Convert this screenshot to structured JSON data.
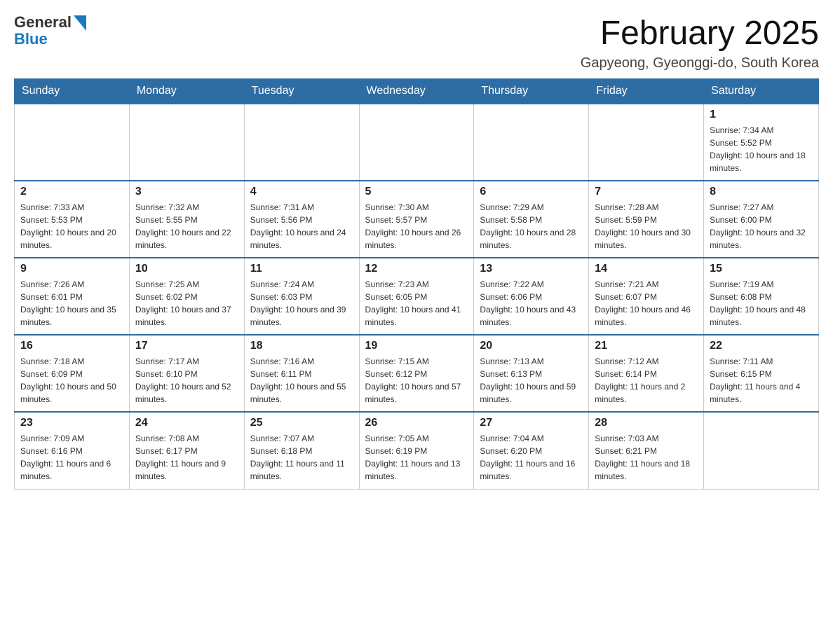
{
  "logo": {
    "general": "General",
    "blue": "Blue"
  },
  "title": "February 2025",
  "subtitle": "Gapyeong, Gyeonggi-do, South Korea",
  "days_of_week": [
    "Sunday",
    "Monday",
    "Tuesday",
    "Wednesday",
    "Thursday",
    "Friday",
    "Saturday"
  ],
  "weeks": [
    [
      {
        "day": "",
        "sunrise": "",
        "sunset": "",
        "daylight": ""
      },
      {
        "day": "",
        "sunrise": "",
        "sunset": "",
        "daylight": ""
      },
      {
        "day": "",
        "sunrise": "",
        "sunset": "",
        "daylight": ""
      },
      {
        "day": "",
        "sunrise": "",
        "sunset": "",
        "daylight": ""
      },
      {
        "day": "",
        "sunrise": "",
        "sunset": "",
        "daylight": ""
      },
      {
        "day": "",
        "sunrise": "",
        "sunset": "",
        "daylight": ""
      },
      {
        "day": "1",
        "sunrise": "Sunrise: 7:34 AM",
        "sunset": "Sunset: 5:52 PM",
        "daylight": "Daylight: 10 hours and 18 minutes."
      }
    ],
    [
      {
        "day": "2",
        "sunrise": "Sunrise: 7:33 AM",
        "sunset": "Sunset: 5:53 PM",
        "daylight": "Daylight: 10 hours and 20 minutes."
      },
      {
        "day": "3",
        "sunrise": "Sunrise: 7:32 AM",
        "sunset": "Sunset: 5:55 PM",
        "daylight": "Daylight: 10 hours and 22 minutes."
      },
      {
        "day": "4",
        "sunrise": "Sunrise: 7:31 AM",
        "sunset": "Sunset: 5:56 PM",
        "daylight": "Daylight: 10 hours and 24 minutes."
      },
      {
        "day": "5",
        "sunrise": "Sunrise: 7:30 AM",
        "sunset": "Sunset: 5:57 PM",
        "daylight": "Daylight: 10 hours and 26 minutes."
      },
      {
        "day": "6",
        "sunrise": "Sunrise: 7:29 AM",
        "sunset": "Sunset: 5:58 PM",
        "daylight": "Daylight: 10 hours and 28 minutes."
      },
      {
        "day": "7",
        "sunrise": "Sunrise: 7:28 AM",
        "sunset": "Sunset: 5:59 PM",
        "daylight": "Daylight: 10 hours and 30 minutes."
      },
      {
        "day": "8",
        "sunrise": "Sunrise: 7:27 AM",
        "sunset": "Sunset: 6:00 PM",
        "daylight": "Daylight: 10 hours and 32 minutes."
      }
    ],
    [
      {
        "day": "9",
        "sunrise": "Sunrise: 7:26 AM",
        "sunset": "Sunset: 6:01 PM",
        "daylight": "Daylight: 10 hours and 35 minutes."
      },
      {
        "day": "10",
        "sunrise": "Sunrise: 7:25 AM",
        "sunset": "Sunset: 6:02 PM",
        "daylight": "Daylight: 10 hours and 37 minutes."
      },
      {
        "day": "11",
        "sunrise": "Sunrise: 7:24 AM",
        "sunset": "Sunset: 6:03 PM",
        "daylight": "Daylight: 10 hours and 39 minutes."
      },
      {
        "day": "12",
        "sunrise": "Sunrise: 7:23 AM",
        "sunset": "Sunset: 6:05 PM",
        "daylight": "Daylight: 10 hours and 41 minutes."
      },
      {
        "day": "13",
        "sunrise": "Sunrise: 7:22 AM",
        "sunset": "Sunset: 6:06 PM",
        "daylight": "Daylight: 10 hours and 43 minutes."
      },
      {
        "day": "14",
        "sunrise": "Sunrise: 7:21 AM",
        "sunset": "Sunset: 6:07 PM",
        "daylight": "Daylight: 10 hours and 46 minutes."
      },
      {
        "day": "15",
        "sunrise": "Sunrise: 7:19 AM",
        "sunset": "Sunset: 6:08 PM",
        "daylight": "Daylight: 10 hours and 48 minutes."
      }
    ],
    [
      {
        "day": "16",
        "sunrise": "Sunrise: 7:18 AM",
        "sunset": "Sunset: 6:09 PM",
        "daylight": "Daylight: 10 hours and 50 minutes."
      },
      {
        "day": "17",
        "sunrise": "Sunrise: 7:17 AM",
        "sunset": "Sunset: 6:10 PM",
        "daylight": "Daylight: 10 hours and 52 minutes."
      },
      {
        "day": "18",
        "sunrise": "Sunrise: 7:16 AM",
        "sunset": "Sunset: 6:11 PM",
        "daylight": "Daylight: 10 hours and 55 minutes."
      },
      {
        "day": "19",
        "sunrise": "Sunrise: 7:15 AM",
        "sunset": "Sunset: 6:12 PM",
        "daylight": "Daylight: 10 hours and 57 minutes."
      },
      {
        "day": "20",
        "sunrise": "Sunrise: 7:13 AM",
        "sunset": "Sunset: 6:13 PM",
        "daylight": "Daylight: 10 hours and 59 minutes."
      },
      {
        "day": "21",
        "sunrise": "Sunrise: 7:12 AM",
        "sunset": "Sunset: 6:14 PM",
        "daylight": "Daylight: 11 hours and 2 minutes."
      },
      {
        "day": "22",
        "sunrise": "Sunrise: 7:11 AM",
        "sunset": "Sunset: 6:15 PM",
        "daylight": "Daylight: 11 hours and 4 minutes."
      }
    ],
    [
      {
        "day": "23",
        "sunrise": "Sunrise: 7:09 AM",
        "sunset": "Sunset: 6:16 PM",
        "daylight": "Daylight: 11 hours and 6 minutes."
      },
      {
        "day": "24",
        "sunrise": "Sunrise: 7:08 AM",
        "sunset": "Sunset: 6:17 PM",
        "daylight": "Daylight: 11 hours and 9 minutes."
      },
      {
        "day": "25",
        "sunrise": "Sunrise: 7:07 AM",
        "sunset": "Sunset: 6:18 PM",
        "daylight": "Daylight: 11 hours and 11 minutes."
      },
      {
        "day": "26",
        "sunrise": "Sunrise: 7:05 AM",
        "sunset": "Sunset: 6:19 PM",
        "daylight": "Daylight: 11 hours and 13 minutes."
      },
      {
        "day": "27",
        "sunrise": "Sunrise: 7:04 AM",
        "sunset": "Sunset: 6:20 PM",
        "daylight": "Daylight: 11 hours and 16 minutes."
      },
      {
        "day": "28",
        "sunrise": "Sunrise: 7:03 AM",
        "sunset": "Sunset: 6:21 PM",
        "daylight": "Daylight: 11 hours and 18 minutes."
      },
      {
        "day": "",
        "sunrise": "",
        "sunset": "",
        "daylight": ""
      }
    ]
  ]
}
